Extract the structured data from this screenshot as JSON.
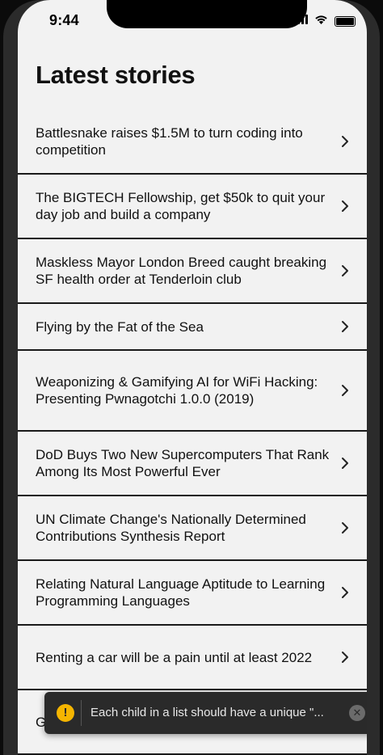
{
  "status_bar": {
    "time": "9:44",
    "battery_level": 1.0
  },
  "page_title": "Latest stories",
  "stories": [
    {
      "title": "Battlesnake raises $1.5M to turn coding into competition"
    },
    {
      "title": "The BIGTECH Fellowship, get $50k to quit your day job and build a company"
    },
    {
      "title": "Maskless Mayor London Breed caught breaking SF health order at Tenderloin club"
    },
    {
      "title": "Flying by the Fat of the Sea"
    },
    {
      "title": "Weaponizing & Gamifying AI for WiFi Hacking: Presenting Pwnagotchi 1.0.0 (2019)"
    },
    {
      "title": "DoD Buys Two New Supercomputers That Rank Among Its Most Powerful Ever"
    },
    {
      "title": "UN Climate Change's Nationally Determined Contributions Synthesis Report"
    },
    {
      "title": "Relating Natural Language Aptitude to Learning Programming Languages"
    },
    {
      "title": "Renting a car will be a pain until at least 2022"
    },
    {
      "title": "GameStop saga star"
    }
  ],
  "toast": {
    "icon": "warning-icon",
    "warning_glyph": "!",
    "message": "Each child in a list should have a unique \"...",
    "close_glyph": "✕"
  },
  "colors": {
    "background": "#f2f2f2",
    "divider": "#1a1a1a",
    "toast_bg": "#2a2a2a",
    "warning": "#f5b500"
  }
}
